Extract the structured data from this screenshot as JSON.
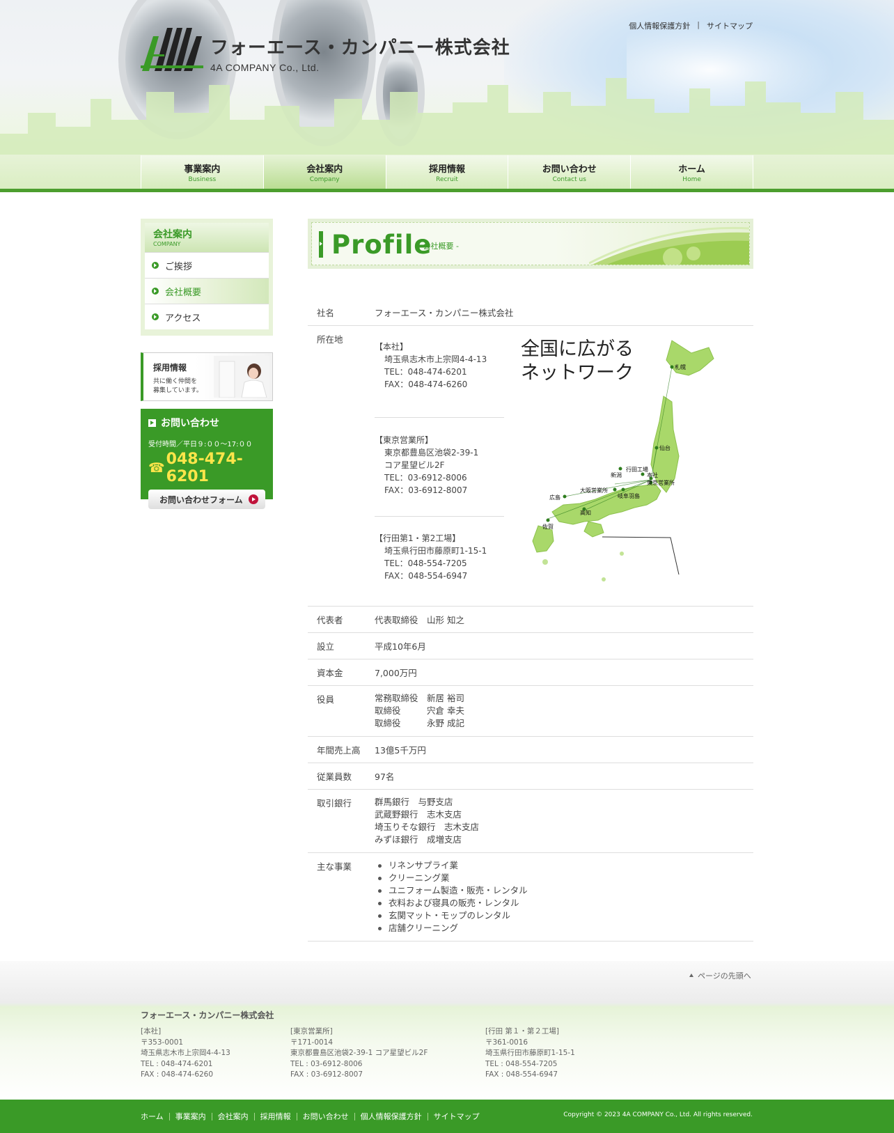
{
  "header": {
    "company_ja": "フォーエース・カンパニー株式会社",
    "company_en": "4A COMPANY Co., Ltd.",
    "top_links": [
      "個人情報保護方針",
      "サイトマップ"
    ],
    "top_links_separator": "|"
  },
  "gnav": [
    {
      "ja": "事業案内",
      "en": "Business"
    },
    {
      "ja": "会社案内",
      "en": "Company"
    },
    {
      "ja": "採用情報",
      "en": "Recruit"
    },
    {
      "ja": "お問い合わせ",
      "en": "Contact us"
    },
    {
      "ja": "ホーム",
      "en": "Home"
    }
  ],
  "sidebar": {
    "heading_ja": "会社案内",
    "heading_en": "COMPANY",
    "items": [
      "ご挨拶",
      "会社概要",
      "アクセス"
    ],
    "recruit": {
      "title": "採用情報",
      "desc1": "共に働く仲間を",
      "desc2": "募集しています。"
    },
    "contact": {
      "title": "お問い合わせ",
      "hours": "受付時間／平日９:００～17:００",
      "phone_icon": "☎",
      "tel": "048-474-6201",
      "form_button": "お問い合わせフォーム"
    }
  },
  "profile": {
    "title": "Profile",
    "subtitle": "- 会社概要 -"
  },
  "table": {
    "company_name": {
      "label": "社名",
      "value": "フォーエース・カンパニー株式会社"
    },
    "address": {
      "label": "所在地",
      "offices": [
        {
          "name": "【本社】",
          "lines": [
            "埼玉県志木市上宗岡4-4-13",
            "TEL：048-474-6201",
            "FAX：048-474-6260"
          ]
        },
        {
          "name": "【東京営業所】",
          "lines": [
            "東京都豊島区池袋2-39-1",
            "コア星望ビル2F",
            "TEL：03-6912-8006",
            "FAX：03-6912-8007"
          ]
        },
        {
          "name": "【行田第1・第2工場】",
          "lines": [
            "埼玉県行田市藤原町1-15-1",
            "TEL：048-554-7205",
            "FAX：048-554-6947"
          ]
        }
      ],
      "network_title_1": "全国に広がる",
      "network_title_2": "ネットワーク",
      "map_labels": [
        "札幌",
        "仙台",
        "新潟",
        "行田工場",
        "本社",
        "東京営業所",
        "大阪営業所",
        "岐阜羽島",
        "広島",
        "高知",
        "佐賀"
      ]
    },
    "representative": {
      "label": "代表者",
      "value": "代表取締役　山形 知之"
    },
    "established": {
      "label": "設立",
      "value": "平成10年6月"
    },
    "capital": {
      "label": "資本金",
      "value": "7,000万円"
    },
    "officers": {
      "label": "役員",
      "lines": [
        "常務取締役　新居 裕司",
        "取締役　　　宍倉 幸夫",
        "取締役　　　永野 成記"
      ]
    },
    "sales": {
      "label": "年間売上高",
      "value": "13億5千万円"
    },
    "employees": {
      "label": "従業員数",
      "value": "97名"
    },
    "banks": {
      "label": "取引銀行",
      "lines": [
        "群馬銀行　与野支店",
        "武蔵野銀行　志木支店",
        "埼玉りそな銀行　志木支店",
        "みずほ銀行　成増支店"
      ]
    },
    "business": {
      "label": "主な事業",
      "items": [
        "リネンサプライ業",
        "クリーニング業",
        "ユニフォーム製造・販売・レンタル",
        "衣料および寝具の販売・レンタル",
        "玄関マット・モップのレンタル",
        "店舗クリーニング"
      ]
    }
  },
  "pagetop": "ページの先頭へ",
  "footer": {
    "company": "フォーエース・カンパニー株式会社",
    "offices": [
      {
        "name": "[本社]",
        "zip": "〒353-0001",
        "addr": "埼玉県志木市上宗岡4-4-13",
        "tel": "TEL : 048-474-6201",
        "fax": "FAX : 048-474-6260"
      },
      {
        "name": "[東京営業所]",
        "zip": "〒171-0014",
        "addr": "東京都豊島区池袋2-39-1 コア星望ビル2F",
        "tel": "TEL : 03-6912-8006",
        "fax": "FAX : 03-6912-8007"
      },
      {
        "name": "[行田 第１・第２工場]",
        "zip": "〒361-0016",
        "addr": "埼玉県行田市藤原町1-15-1",
        "tel": "TEL : 048-554-7205",
        "fax": "FAX : 048-554-6947"
      }
    ],
    "links": [
      "ホーム",
      "事業案内",
      "会社案内",
      "採用情報",
      "お問い合わせ",
      "個人情報保護方針",
      "サイトマップ"
    ],
    "copyright": "Copyright © 2023 4A COMPANY Co., Ltd. All rights reserved."
  },
  "colors": {
    "brand_green": "#3a9a27",
    "light_green": "#e5f0d7",
    "tel_yellow": "#ffe54a"
  }
}
